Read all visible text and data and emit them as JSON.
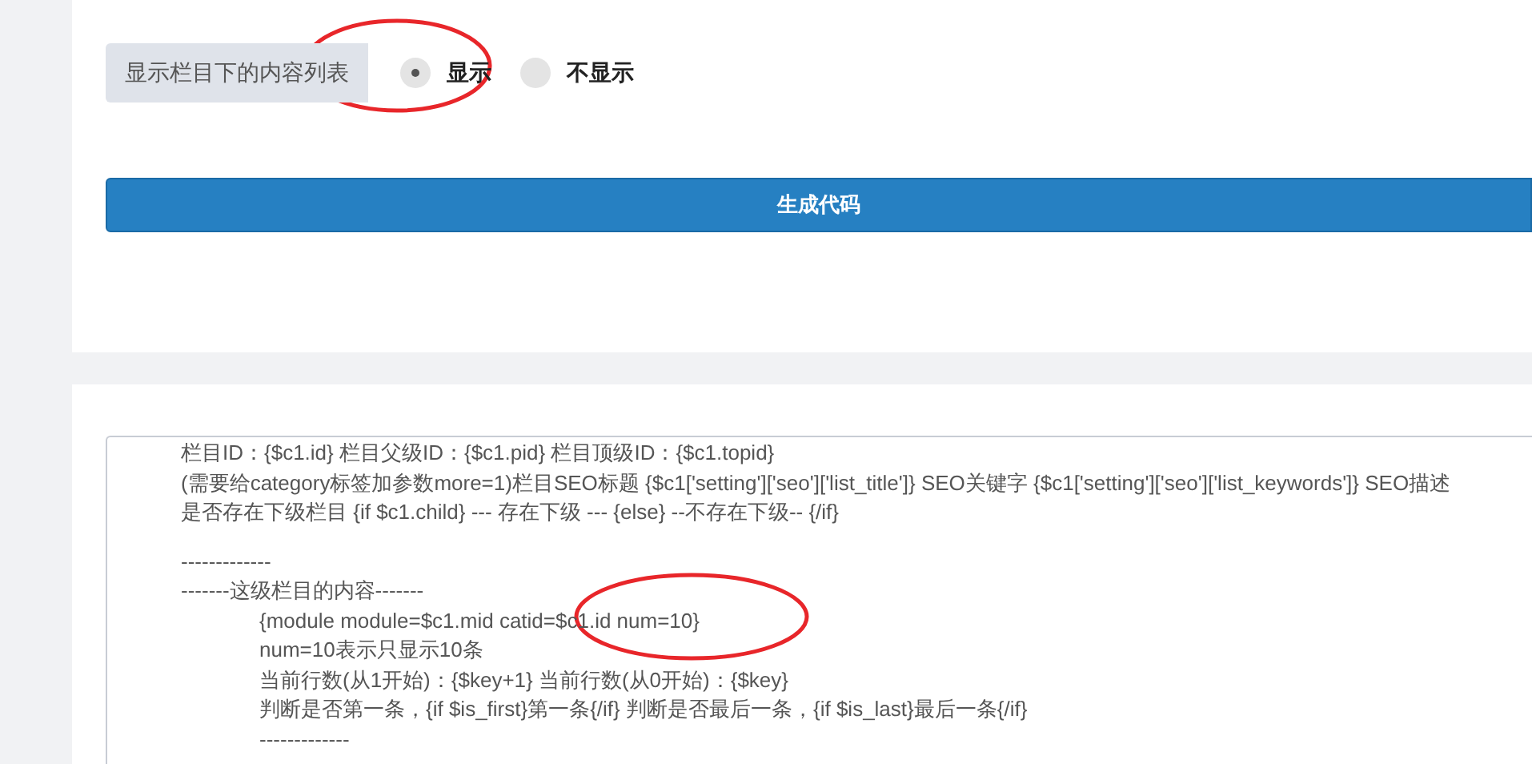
{
  "display_option": {
    "label": "显示栏目下的内容列表",
    "options": [
      {
        "label": "显示",
        "selected": true
      },
      {
        "label": "不显示",
        "selected": false
      }
    ]
  },
  "generate_button": "生成代码",
  "code": {
    "sections": [
      {
        "lines": [
          {
            "text": "栏目ID：{$c1.id} 栏目父级ID：{$c1.pid} 栏目顶级ID：{$c1.topid}",
            "indented": false
          },
          {
            "text": "(需要给category标签加参数more=1)栏目SEO标题 {$c1['setting']['seo']['list_title']} SEO关键字 {$c1['setting']['seo']['list_keywords']} SEO描述",
            "indented": false
          },
          {
            "text": "是否存在下级栏目 {if $c1.child} --- 存在下级 --- {else} --不存在下级-- {/if}",
            "indented": false
          }
        ]
      },
      {
        "lines": [
          {
            "text": "-------------",
            "indented": false
          },
          {
            "text": "-------这级栏目的内容-------",
            "indented": false
          },
          {
            "text": "{module module=$c1.mid catid=$c1.id num=10}",
            "indented": true
          },
          {
            "text": "num=10表示只显示10条",
            "indented": true
          },
          {
            "text": "当前行数(从1开始)：{$key+1} 当前行数(从0开始)：{$key}",
            "indented": true
          },
          {
            "text": "判断是否第一条，{if $is_first}第一条{/if} 判断是否最后一条，{if $is_last}最后一条{/if}",
            "indented": true
          },
          {
            "text": "-------------",
            "indented": true
          }
        ]
      }
    ]
  }
}
